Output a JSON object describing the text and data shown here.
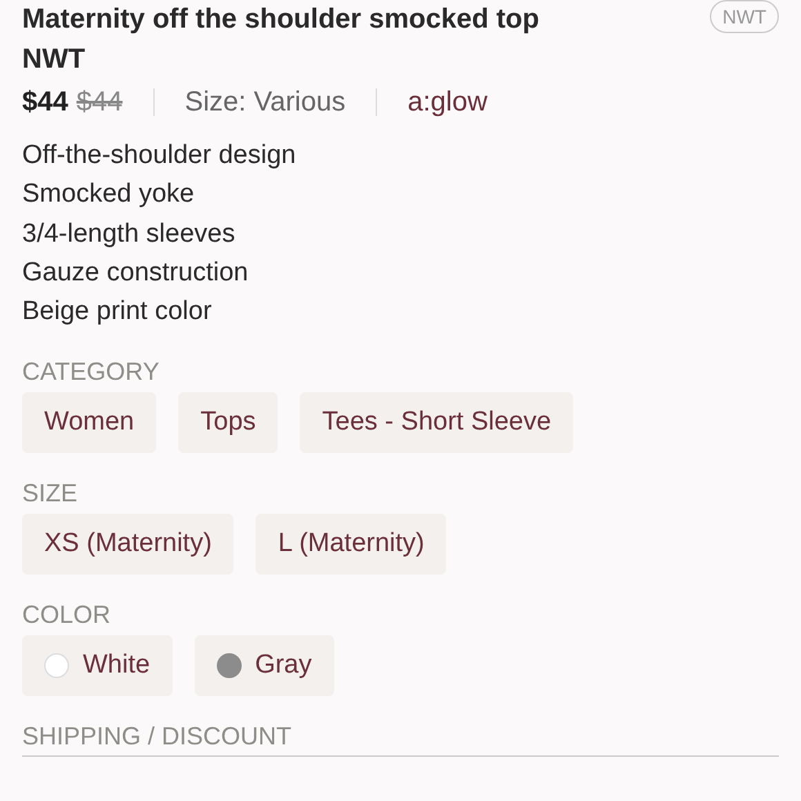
{
  "listing": {
    "title": "Maternity off the shoulder smocked top NWT",
    "badge": "NWT",
    "price": "$44",
    "original_price": "$44",
    "size": "Size: Various",
    "brand": "a:glow"
  },
  "description": [
    "Off-the-shoulder design",
    "Smocked yoke",
    "3/4-length sleeves",
    "Gauze construction",
    "Beige print color"
  ],
  "sections": [
    {
      "kind": "tags",
      "heading": "CATEGORY",
      "items": [
        {
          "label": "Women"
        },
        {
          "label": "Tops"
        },
        {
          "label": "Tees - Short Sleeve"
        }
      ]
    },
    {
      "kind": "tags",
      "heading": "SIZE",
      "items": [
        {
          "label": "XS (Maternity)"
        },
        {
          "label": "L (Maternity)"
        }
      ]
    },
    {
      "kind": "colors",
      "heading": "COLOR",
      "items": [
        {
          "label": "White",
          "color": "#ffffff"
        },
        {
          "label": "Gray",
          "color": "#8c8c8c"
        }
      ]
    },
    {
      "kind": "heading",
      "heading": "SHIPPING / DISCOUNT"
    }
  ]
}
